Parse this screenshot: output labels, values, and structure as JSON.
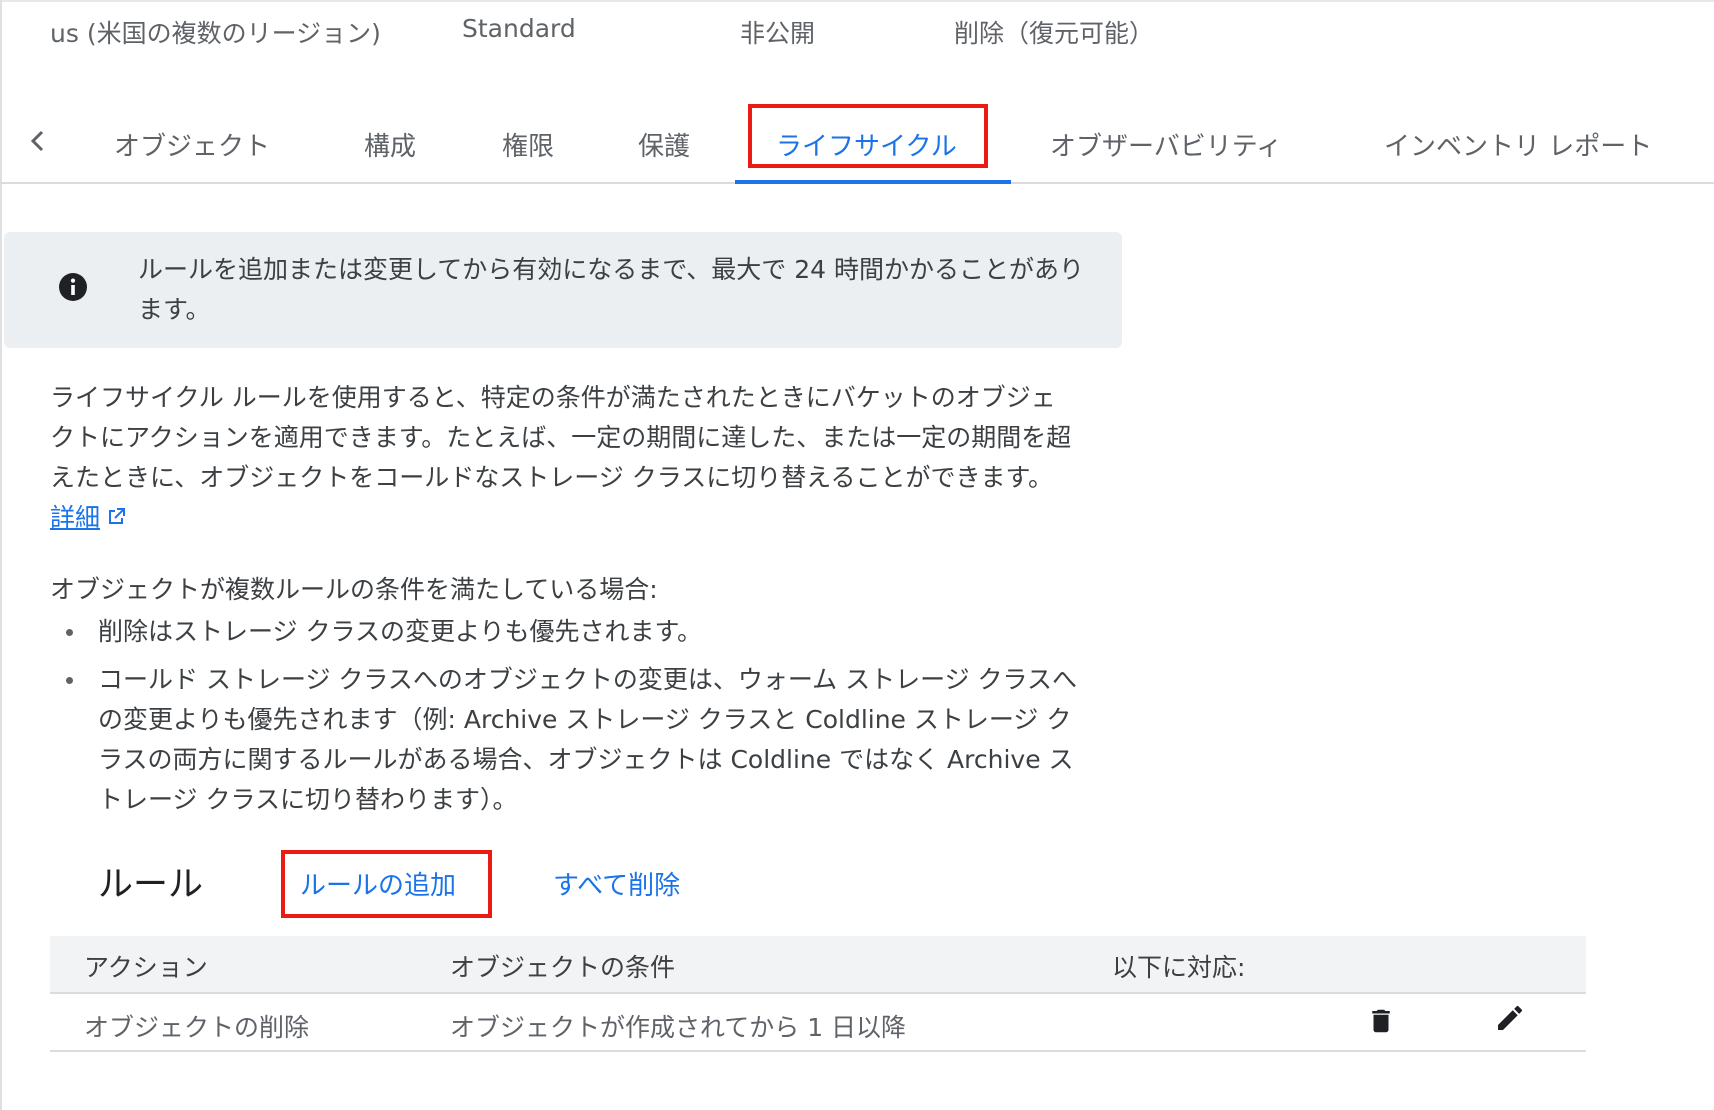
{
  "summary": {
    "location": "us (米国の複数のリージョン)",
    "storage_class": "Standard",
    "public_access": "非公開",
    "protection": "削除（復元可能）"
  },
  "tabs": [
    {
      "label": "オブジェクト",
      "active": false
    },
    {
      "label": "構成",
      "active": false
    },
    {
      "label": "権限",
      "active": false
    },
    {
      "label": "保護",
      "active": false
    },
    {
      "label": "ライフサイクル",
      "active": true
    },
    {
      "label": "オブザーバビリティ",
      "active": false
    },
    {
      "label": "インベントリ レポート",
      "active": false
    }
  ],
  "info_banner": {
    "icon": "info-icon",
    "text": "ルールを追加または変更してから有効になるまで、最大で 24 時間かかることがあります。"
  },
  "description": {
    "text": "ライフサイクル ルールを使用すると、特定の条件が満たされたときにバケットのオブジェクトにアクションを適用できます。たとえば、一定の期間に達した、または一定の期間を超えたときに、オブジェクトをコールドなストレージ クラスに切り替えることができます。",
    "learn_more": "詳細",
    "learn_more_icon": "external-link-icon"
  },
  "conflict": {
    "title": "オブジェクトが複数ルールの条件を満たしている場合:",
    "items": [
      "削除はストレージ クラスの変更よりも優先されます。",
      "コールド ストレージ クラスへのオブジェクトの変更は、ウォーム ストレージ クラスへの変更よりも優先されます（例: Archive ストレージ クラスと Coldline ストレージ クラスの両方に関するルールがある場合、オブジェクトは Coldline ではなく Archive ストレージ クラスに切り替わります）。"
    ]
  },
  "rules": {
    "title": "ルール",
    "add_label": "ルールの追加",
    "delete_all_label": "すべて削除",
    "columns": [
      "アクション",
      "オブジェクトの条件",
      "以下に対応:"
    ],
    "rows": [
      {
        "action": "オブジェクトの削除",
        "condition": "オブジェクトが作成されてから 1 日以降",
        "matches": ""
      }
    ]
  },
  "colors": {
    "accent": "#1a73e8",
    "highlight": "#ea1b14",
    "banner_bg": "#eceff1"
  }
}
